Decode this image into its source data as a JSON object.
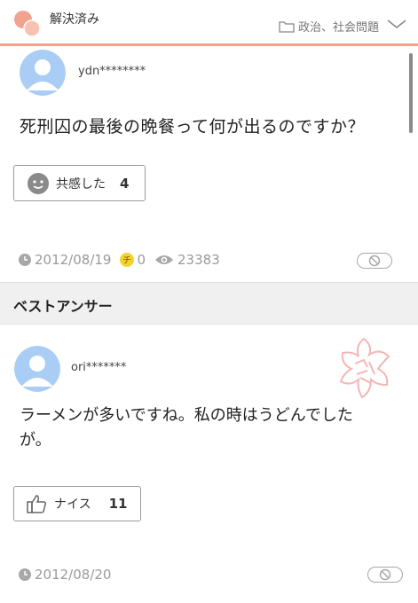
{
  "header": {
    "status": "解決済み",
    "category": "政治、社会問題"
  },
  "question": {
    "username": "ydn********",
    "text": "死刑囚の最後の晩餐って何が出るのですか？",
    "empathy_label": "共感した",
    "empathy_count": "4",
    "date": "2012/08/19",
    "chie_coins": "0",
    "views": "23383"
  },
  "best_answer": {
    "section_title": "ベストアンサー",
    "username": "ori*******",
    "text_line1": "ラーメンが多いですね。私の時はうどんでした",
    "text_line2": "が。",
    "nice_label": "ナイス",
    "nice_count": "11",
    "date": "2012/08/20"
  },
  "colors": {
    "accent": "#f2a38f",
    "stamp": "#f4b6b6",
    "avatar_bg": "#a9cdf5"
  },
  "icons": [
    "speech-bubbles-icon",
    "folder-icon",
    "chevron-down-icon",
    "face-icon",
    "clock-icon",
    "chie-coin-icon",
    "eye-icon",
    "report-icon",
    "thumbs-up-icon"
  ]
}
